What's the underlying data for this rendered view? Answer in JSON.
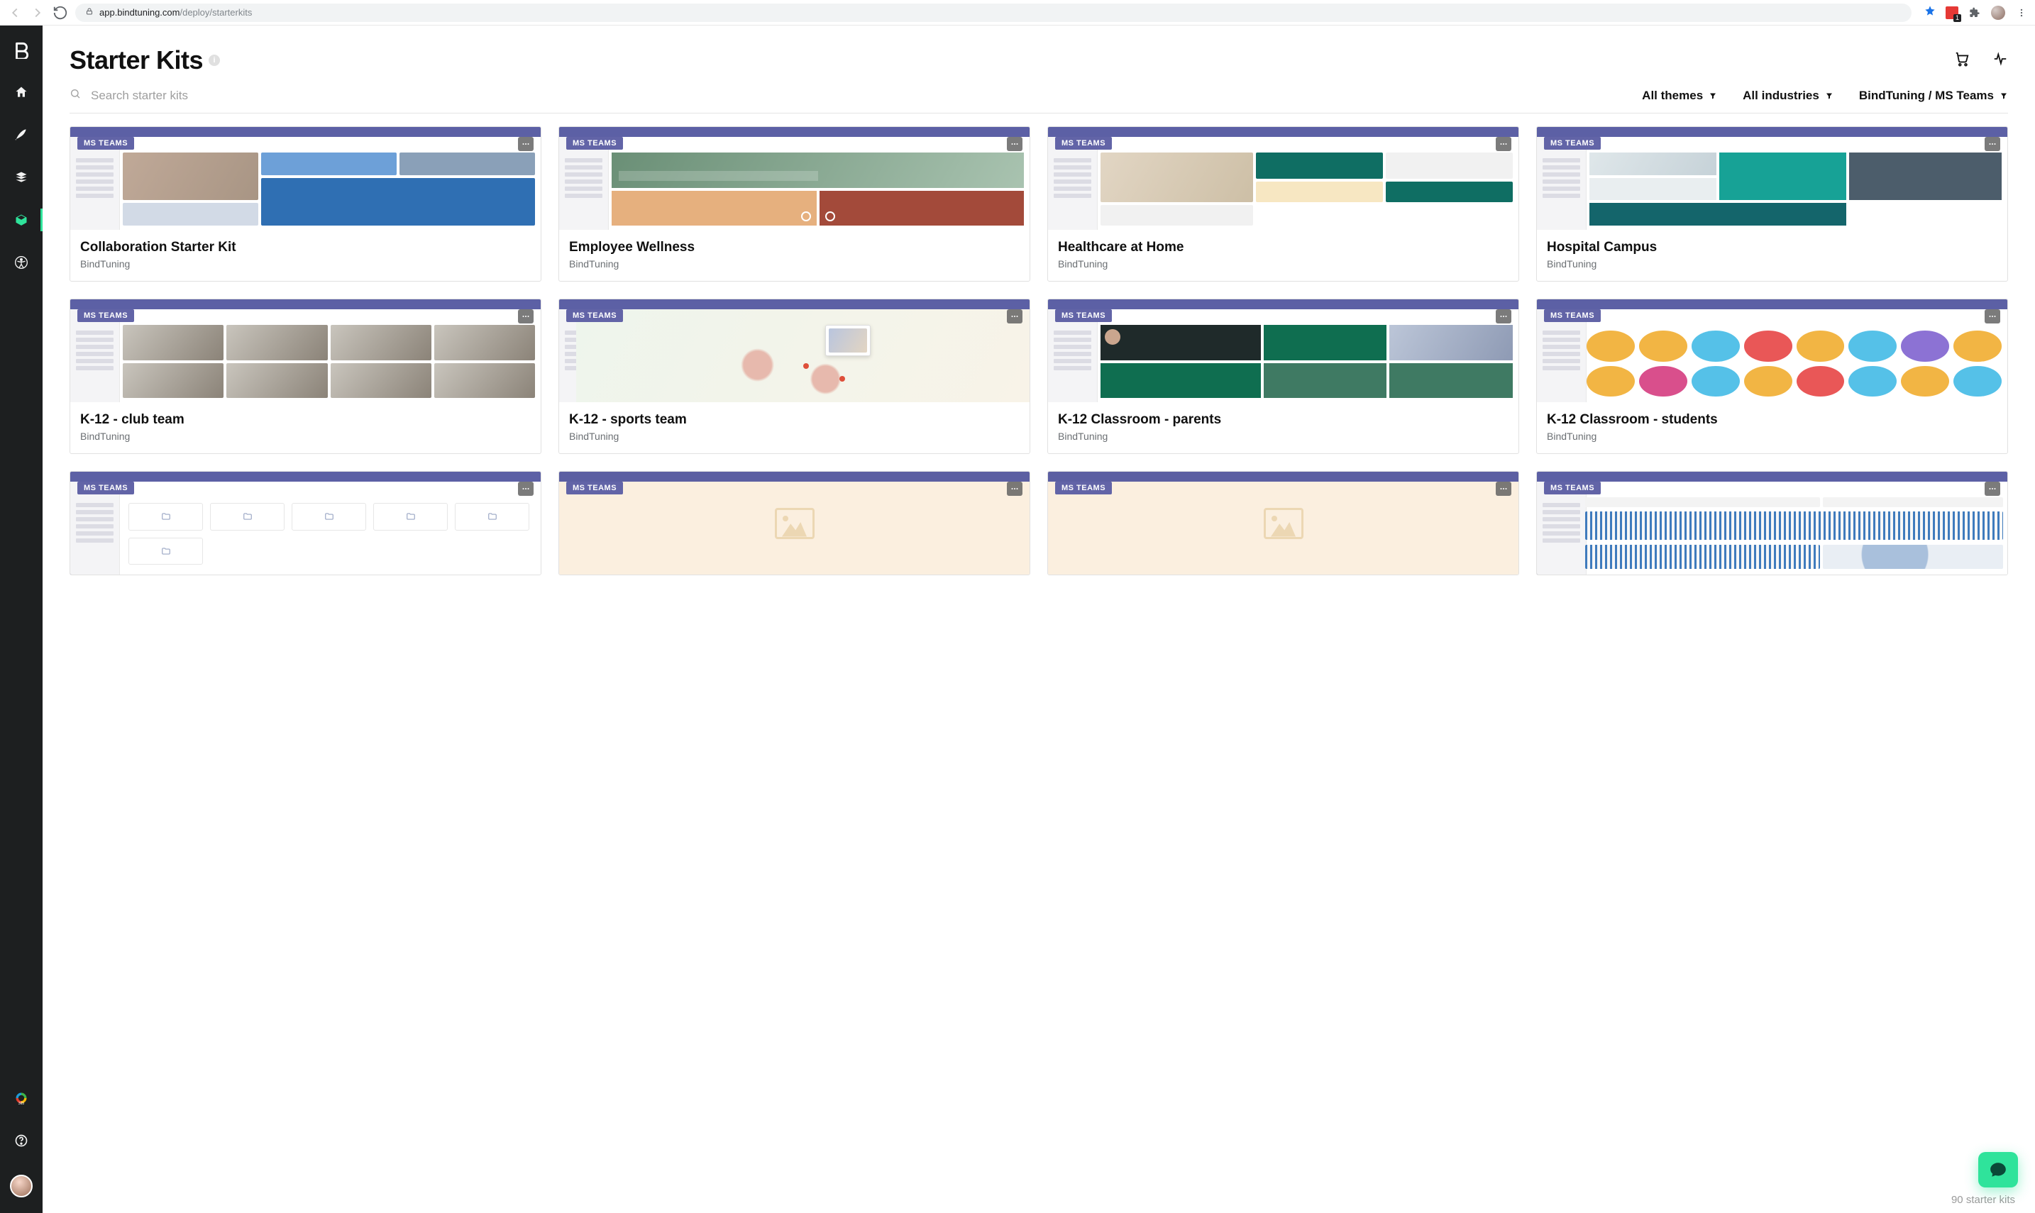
{
  "browser": {
    "secure": true,
    "url_host": "app.bindtuning.com",
    "url_path": "/deploy/starterkits"
  },
  "page": {
    "title": "Starter Kits"
  },
  "search": {
    "placeholder": "Search starter kits"
  },
  "filters": {
    "themes": "All themes",
    "industries": "All industries",
    "platform": "BindTuning / MS Teams"
  },
  "badge": {
    "ms_teams": "MS TEAMS"
  },
  "cards": [
    {
      "title": "Collaboration Starter Kit",
      "author": "BindTuning",
      "variant": "v1",
      "loading": false
    },
    {
      "title": "Employee Wellness",
      "author": "BindTuning",
      "variant": "v2",
      "loading": false
    },
    {
      "title": "Healthcare at Home",
      "author": "BindTuning",
      "variant": "v3",
      "loading": false
    },
    {
      "title": "Hospital Campus",
      "author": "BindTuning",
      "variant": "v4",
      "loading": false
    },
    {
      "title": "K-12 - club team",
      "author": "BindTuning",
      "variant": "v5",
      "loading": false
    },
    {
      "title": "K-12 - sports team",
      "author": "BindTuning",
      "variant": "v6",
      "loading": false
    },
    {
      "title": "K-12 Classroom - parents",
      "author": "BindTuning",
      "variant": "v7",
      "loading": false
    },
    {
      "title": "K-12 Classroom - students",
      "author": "BindTuning",
      "variant": "v8",
      "loading": false
    },
    {
      "title": "",
      "author": "",
      "variant": "v9",
      "loading": false
    },
    {
      "title": "",
      "author": "",
      "variant": "v10",
      "loading": true
    },
    {
      "title": "",
      "author": "",
      "variant": "v11",
      "loading": true
    },
    {
      "title": "",
      "author": "",
      "variant": "v12",
      "loading": false
    }
  ],
  "footer": {
    "count": "90 starter kits"
  },
  "avatar_colors": [
    "#f2b544",
    "#f2b544",
    "#55c1e8",
    "#e95757",
    "#f2b544",
    "#55c1e8",
    "#8c72d4",
    "#f2b544",
    "#f2b544",
    "#d94f8c",
    "#55c1e8",
    "#f2b544",
    "#e95757",
    "#55c1e8",
    "#f2b544",
    "#55c1e8"
  ]
}
